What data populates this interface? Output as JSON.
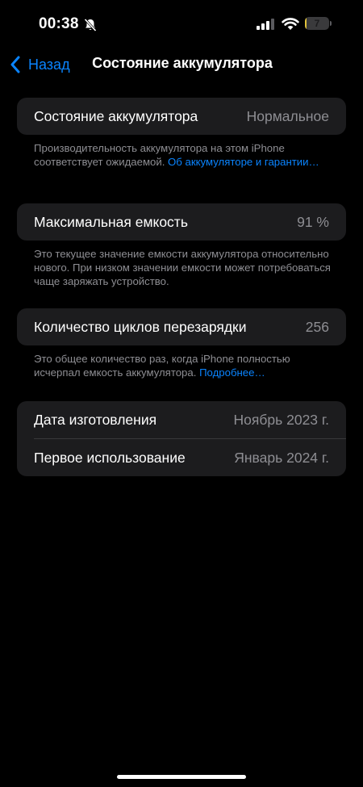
{
  "status_bar": {
    "time": "00:38",
    "battery_level": "7"
  },
  "nav": {
    "back_label": "Назад",
    "title": "Состояние аккумулятора"
  },
  "battery_state": {
    "label": "Состояние аккумулятора",
    "value": "Нормальное",
    "footer_text": "Производительность аккумулятора на этом iPhone соответствует ожидаемой. ",
    "footer_link": "Об аккумуляторе и гарантии…"
  },
  "max_capacity": {
    "label": "Максимальная емкость",
    "value": "91 %",
    "footer_text": "Это текущее значение емкости аккумулятора относительно нового. При низком значении емкости может потребоваться чаще заряжать устройство."
  },
  "cycle_count": {
    "label": "Количество циклов перезарядки",
    "value": "256",
    "footer_text": "Это общее количество раз, когда iPhone полностью исчерпал емкость аккумулятора. ",
    "footer_link": "Подробнее…"
  },
  "dates": {
    "manufacture_label": "Дата изготовления",
    "manufacture_value": "Ноябрь 2023 г.",
    "first_use_label": "Первое использование",
    "first_use_value": "Январь 2024 г."
  },
  "colors": {
    "accent": "#0a84ff",
    "battery_fill": "#e0c23a"
  }
}
